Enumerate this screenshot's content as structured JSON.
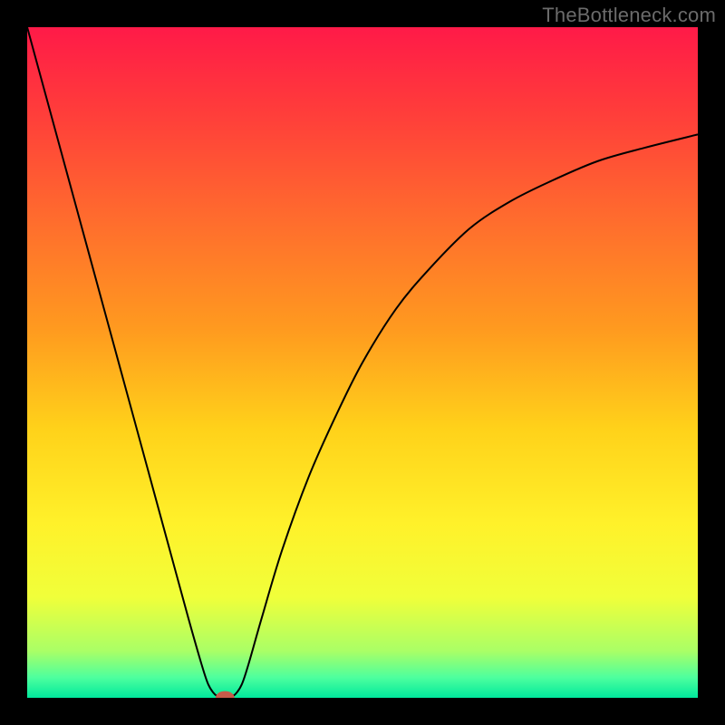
{
  "attribution": "TheBottleneck.com",
  "chart_data": {
    "type": "line",
    "title": "",
    "xlabel": "",
    "ylabel": "",
    "xlim": [
      0,
      100
    ],
    "ylim": [
      0,
      100
    ],
    "grid": false,
    "legend": false,
    "background": {
      "style": "vertical-gradient",
      "stops": [
        {
          "pos": 0.0,
          "color": "#ff1a48"
        },
        {
          "pos": 0.12,
          "color": "#ff3b3b"
        },
        {
          "pos": 0.28,
          "color": "#ff6a2e"
        },
        {
          "pos": 0.45,
          "color": "#ff9a1f"
        },
        {
          "pos": 0.6,
          "color": "#ffd21a"
        },
        {
          "pos": 0.74,
          "color": "#fff12a"
        },
        {
          "pos": 0.85,
          "color": "#f0ff3a"
        },
        {
          "pos": 0.93,
          "color": "#aaff66"
        },
        {
          "pos": 0.97,
          "color": "#4dff9e"
        },
        {
          "pos": 1.0,
          "color": "#00e89c"
        }
      ]
    },
    "series": [
      {
        "name": "bottleneck-curve",
        "color": "#000000",
        "x": [
          0,
          3,
          6,
          9,
          12,
          15,
          18,
          21,
          24,
          26,
          27,
          28,
          29,
          30,
          31,
          32,
          33,
          35,
          38,
          42,
          46,
          50,
          55,
          60,
          66,
          72,
          78,
          85,
          92,
          100
        ],
        "y": [
          100,
          89,
          78,
          67,
          56,
          45,
          34,
          23,
          12,
          5,
          2,
          0.5,
          0,
          0,
          0.5,
          2,
          5,
          12,
          22,
          33,
          42,
          50,
          58,
          64,
          70,
          74,
          77,
          80,
          82,
          84
        ]
      }
    ],
    "marker": {
      "name": "optimal-point",
      "cx": 29.5,
      "cy": 0,
      "rx": 1.4,
      "ry": 1.0,
      "color": "#c85a4a"
    }
  }
}
